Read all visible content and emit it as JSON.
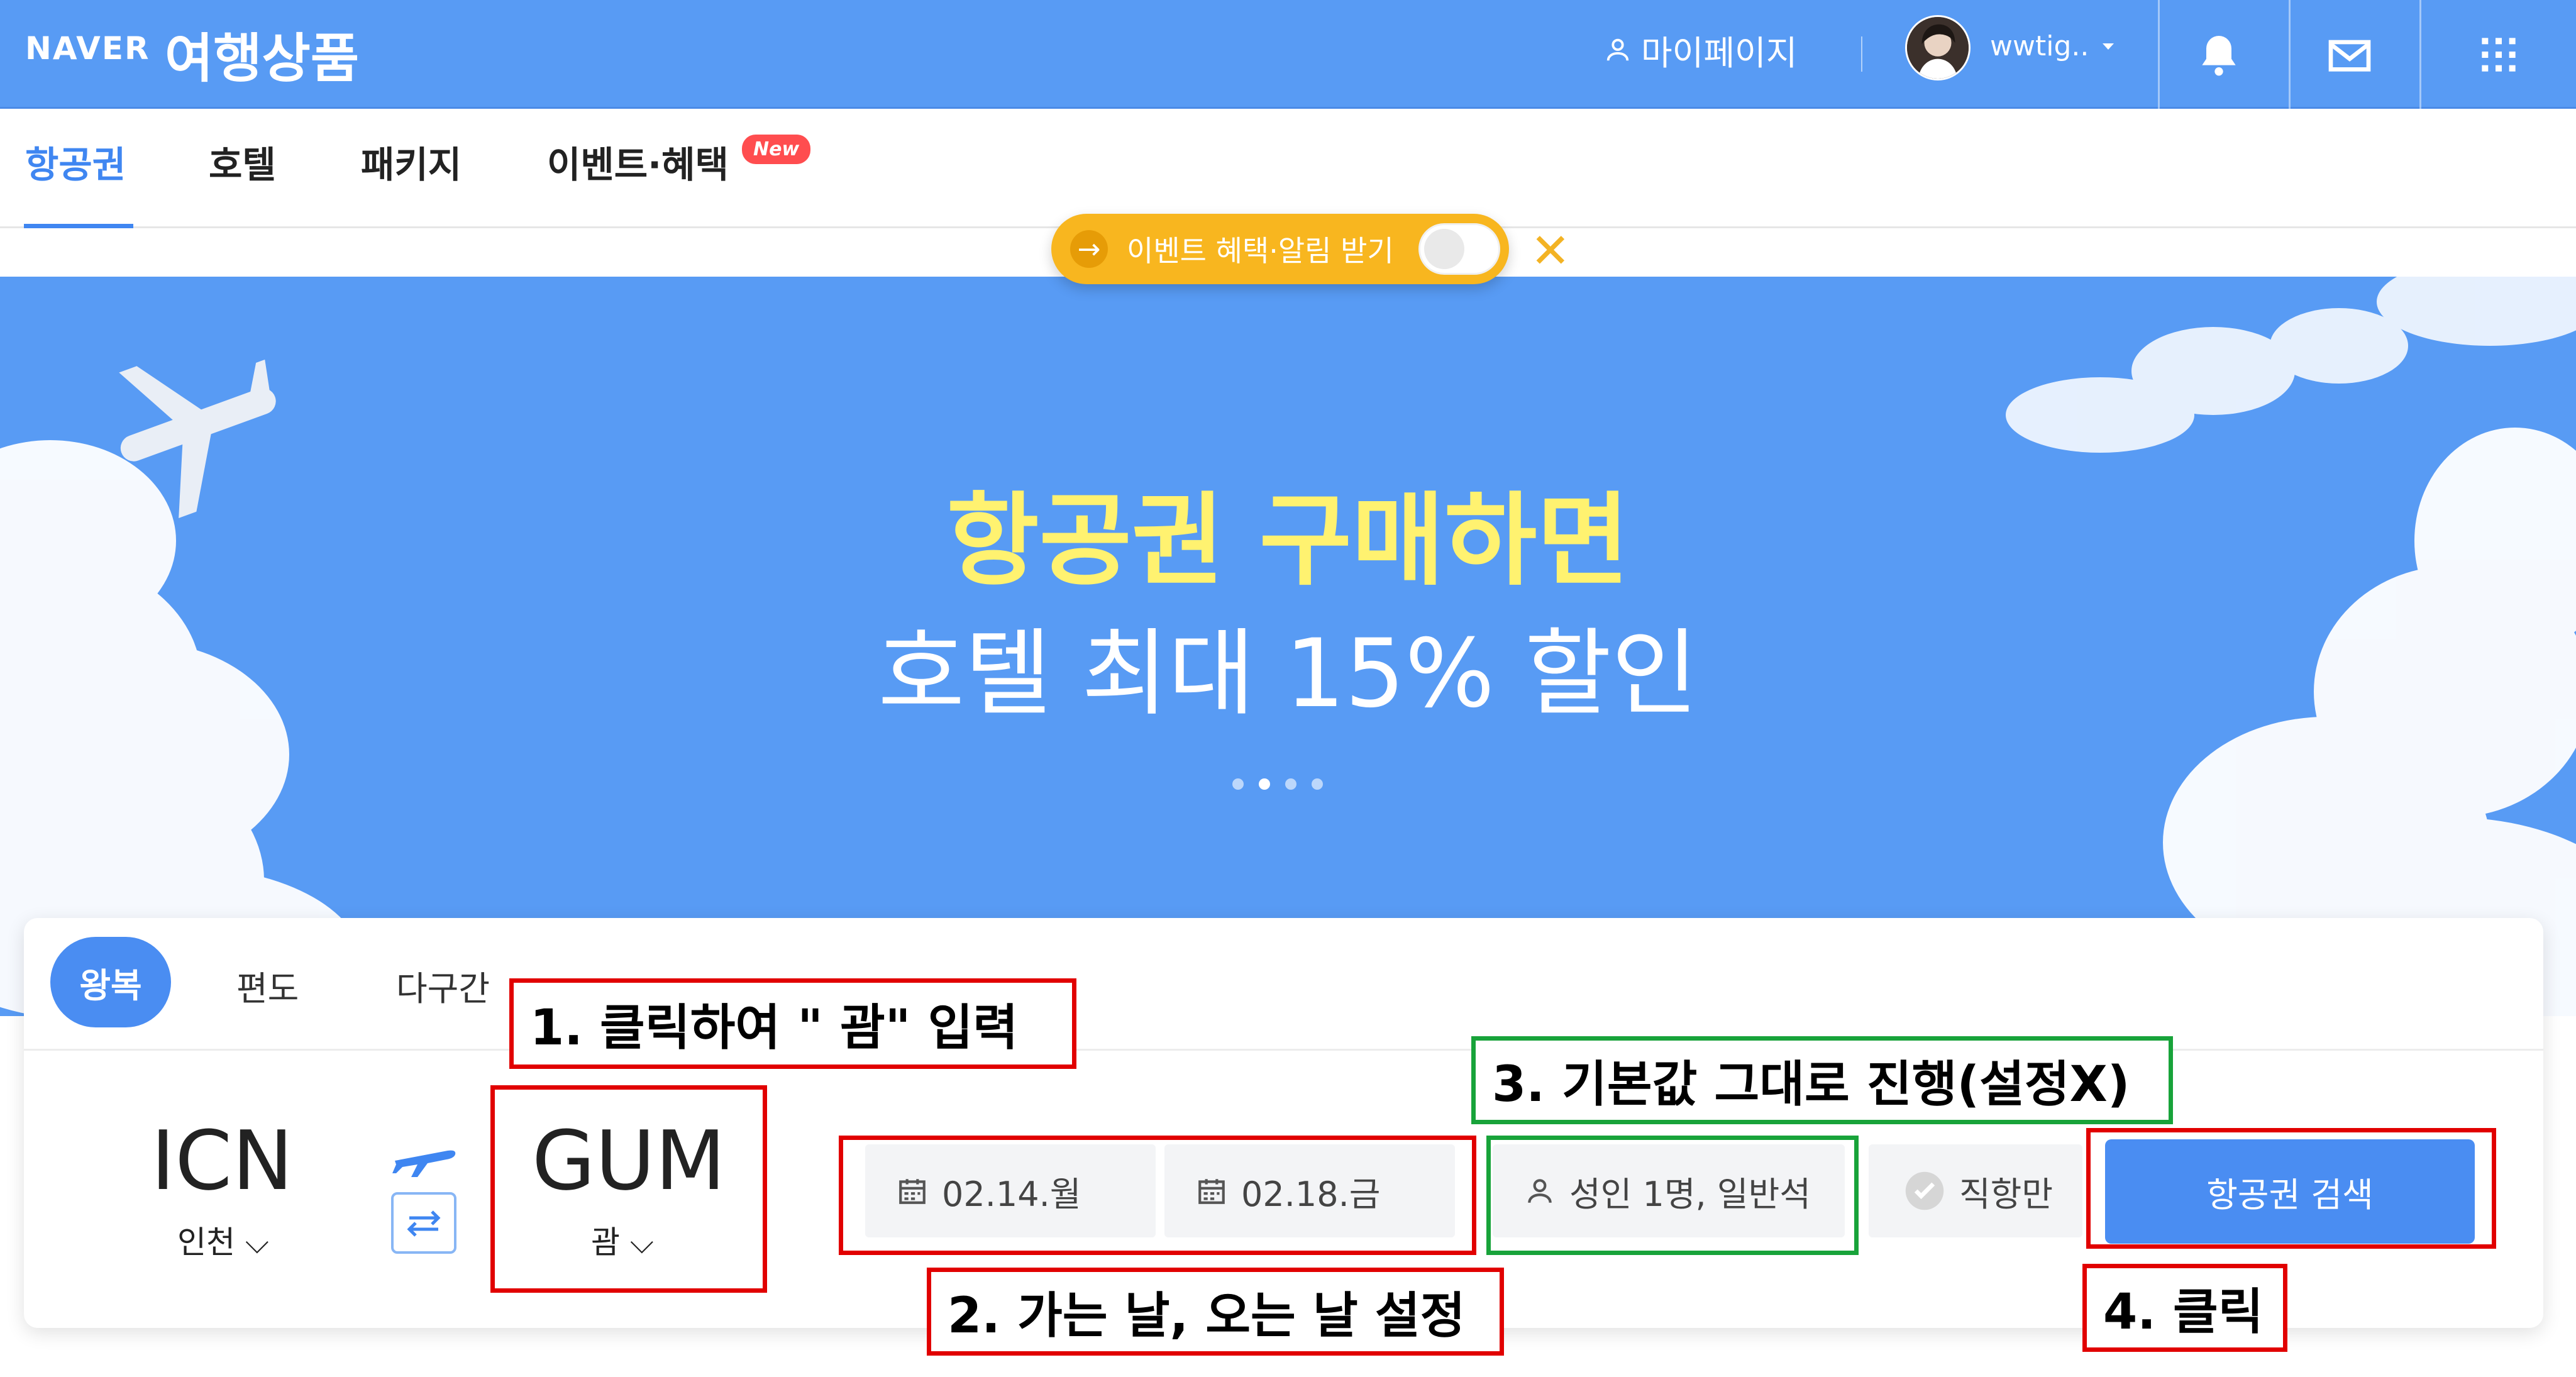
{
  "header": {
    "brand": "NAVER",
    "service": "여행상품",
    "mypage": "마이페이지",
    "username": "wwtig..",
    "icons": [
      "user-icon",
      "bell-icon",
      "mail-icon",
      "grid-icon"
    ]
  },
  "tabs": [
    {
      "label": "항공권",
      "active": true
    },
    {
      "label": "호텔"
    },
    {
      "label": "패키지"
    },
    {
      "label": "이벤트·혜택"
    }
  ],
  "new_badge": "New",
  "event_bar": {
    "arrow": "→",
    "label": "이벤트 혜택·알림 받기",
    "close": "✕"
  },
  "banner": {
    "line1": "항공권 구매하면",
    "line2": "호텔 최대 15% 할인",
    "slides": 4,
    "active_slide": 2
  },
  "search": {
    "trip_types": [
      "왕복",
      "편도",
      "다구간"
    ],
    "origin": {
      "code": "ICN",
      "name": "인천 ⌵"
    },
    "destination": {
      "code": "GUM",
      "name": "괌 ⌵"
    },
    "depart_date": "02.14.월",
    "return_date": "02.18.금",
    "passengers": "성인 1명, 일반석",
    "direct_only": "직항만",
    "search_button": "항공권 검색"
  },
  "annotations": {
    "step1": "1. 클릭하여 \" 괌\" 입력",
    "step2": "2. 가는 날, 오는 날 설정",
    "step3": "3. 기본값 그대로 진행(설정X)",
    "step4": "4. 클릭"
  },
  "colors": {
    "primary_blue": "#589BF4",
    "button_blue": "#4A8DF2",
    "headline_yellow": "#FFF270",
    "event_orange": "#F8B61F",
    "annotation_red": "#E10000",
    "annotation_green": "#18A33A"
  }
}
